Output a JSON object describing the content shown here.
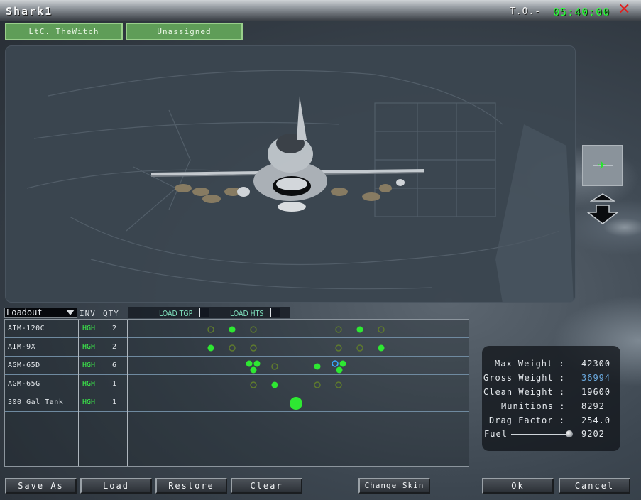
{
  "window": {
    "title": "Shark1",
    "to_label": "T.O.-",
    "to_time": "05:40:00",
    "close_icon": "close-icon"
  },
  "pilots": [
    {
      "label": "LtC. TheWitch"
    },
    {
      "label": "Unassigned"
    }
  ],
  "loadout": {
    "select_value": "Loadout",
    "headers": {
      "inv": "INV",
      "qty": "QTY",
      "load_tgp": "LOAD TGP",
      "load_hts": "LOAD HTS"
    },
    "rows": [
      {
        "name": "AIM-120C",
        "inv": "HGH",
        "qty": "2"
      },
      {
        "name": "AIM-9X",
        "inv": "HGH",
        "qty": "2"
      },
      {
        "name": "AGM-65D",
        "inv": "HGH",
        "qty": "6"
      },
      {
        "name": "AGM-65G",
        "inv": "HGH",
        "qty": "1"
      },
      {
        "name": "300 Gal Tank",
        "inv": "HGH",
        "qty": "1"
      },
      {
        "name": "",
        "inv": "",
        "qty": ""
      },
      {
        "name": "",
        "inv": "",
        "qty": ""
      },
      {
        "name": "",
        "inv": "",
        "qty": ""
      }
    ]
  },
  "stats": {
    "max_weight_label": "Max Weight :",
    "max_weight": "42300",
    "gross_weight_label": "Gross Weight :",
    "gross_weight": "36994",
    "clean_weight_label": "Clean Weight :",
    "clean_weight": "19600",
    "munitions_label": "Munitions :",
    "munitions": "8292",
    "drag_label": "Drag Factor :",
    "drag": "254.0",
    "fuel_label": "Fuel",
    "fuel": "9202",
    "fuel_slider_fraction": 1.0
  },
  "buttons": {
    "save_as": "Save As",
    "load": "Load",
    "restore": "Restore",
    "clear": "Clear",
    "change_skin": "Change Skin",
    "ok": "Ok",
    "cancel": "Cancel"
  },
  "colors": {
    "accent_green": "#2bff3a",
    "hardpoint_loaded": "#2ee832",
    "hardpoint_selected": "#39a9ff",
    "close_red": "#e01e1e",
    "gross_weight_blue": "#6aa9de"
  },
  "hardpoints": {
    "stations": [
      1,
      2,
      3,
      4,
      5,
      6,
      7,
      8,
      9
    ],
    "rows": [
      [
        "",
        "",
        "loaded",
        "",
        "empty",
        "",
        "empty",
        "loaded",
        "empty"
      ],
      [
        "loaded",
        "empty",
        "empty",
        "",
        "",
        "",
        "empty",
        "empty",
        "loaded"
      ]
    ]
  }
}
